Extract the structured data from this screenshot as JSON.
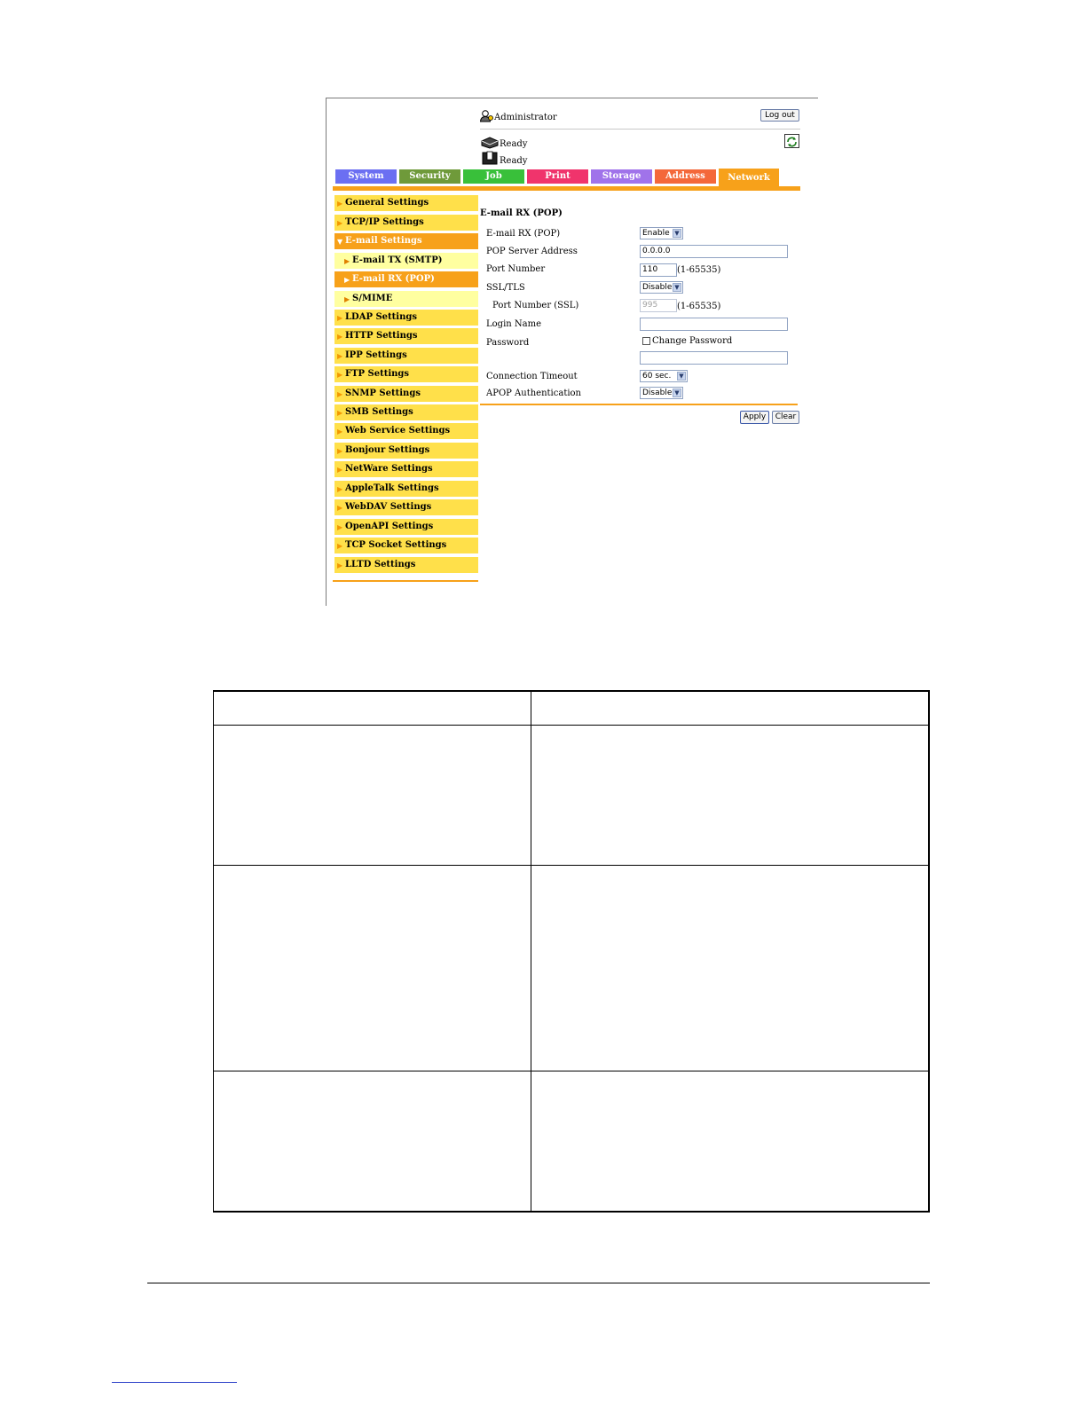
{
  "header": {
    "user_label": "Administrator",
    "logout_label": "Log out",
    "status_1": "Ready",
    "status_2": "Ready"
  },
  "tabs": [
    {
      "label": "System",
      "color": "#6b6ff2"
    },
    {
      "label": "Security",
      "color": "#6f9a3a"
    },
    {
      "label": "Job",
      "color": "#39c03a"
    },
    {
      "label": "Print",
      "color": "#f0346c"
    },
    {
      "label": "Storage",
      "color": "#a073ea"
    },
    {
      "label": "Address",
      "color": "#f4683a"
    },
    {
      "label": "Network",
      "color": "#f7a11a"
    }
  ],
  "sidebar": {
    "items": [
      {
        "label": "General Settings"
      },
      {
        "label": "TCP/IP Settings"
      },
      {
        "label": "E-mail Settings"
      },
      {
        "label": "E-mail TX (SMTP)"
      },
      {
        "label": "E-mail RX (POP)"
      },
      {
        "label": "S/MIME"
      },
      {
        "label": "LDAP Settings"
      },
      {
        "label": "HTTP Settings"
      },
      {
        "label": "IPP Settings"
      },
      {
        "label": "FTP Settings"
      },
      {
        "label": "SNMP Settings"
      },
      {
        "label": "SMB Settings"
      },
      {
        "label": "Web Service Settings"
      },
      {
        "label": "Bonjour Settings"
      },
      {
        "label": "NetWare Settings"
      },
      {
        "label": "AppleTalk Settings"
      },
      {
        "label": "WebDAV Settings"
      },
      {
        "label": "OpenAPI Settings"
      },
      {
        "label": "TCP Socket Settings"
      },
      {
        "label": "LLTD Settings"
      }
    ]
  },
  "form": {
    "title": "E-mail RX (POP)",
    "fields": [
      {
        "label": "E-mail RX (POP)",
        "value": "Enable"
      },
      {
        "label": "POP Server Address",
        "value": "0.0.0.0"
      },
      {
        "label": "Port Number",
        "value": "110",
        "hint": "(1-65535)"
      },
      {
        "label": "SSL/TLS",
        "value": "Disable"
      },
      {
        "label": "Port Number (SSL)",
        "value": "995",
        "hint": "(1-65535)"
      },
      {
        "label": "Login Name",
        "value": ""
      },
      {
        "label": "Password",
        "checkbox_label": "Change Password",
        "value": ""
      },
      {
        "label": "Connection Timeout",
        "value": "60 sec."
      },
      {
        "label": "APOP Authentication",
        "value": "Disable"
      }
    ],
    "apply_label": "Apply",
    "clear_label": "Clear"
  }
}
